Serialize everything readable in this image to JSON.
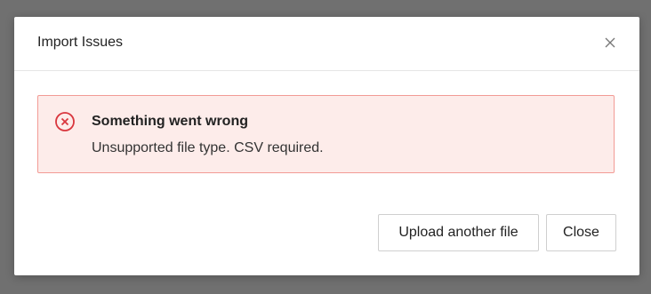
{
  "modal": {
    "title": "Import Issues",
    "close_icon": "close-icon"
  },
  "alert": {
    "icon": "error-circle-x-icon",
    "title": "Something went wrong",
    "message": "Unsupported file type. CSV required."
  },
  "footer": {
    "upload_label": "Upload another file",
    "close_label": "Close"
  },
  "colors": {
    "overlay": "#707070",
    "alert_bg": "#fdecea",
    "alert_border": "#f29b95",
    "error_icon": "#d9363e"
  }
}
